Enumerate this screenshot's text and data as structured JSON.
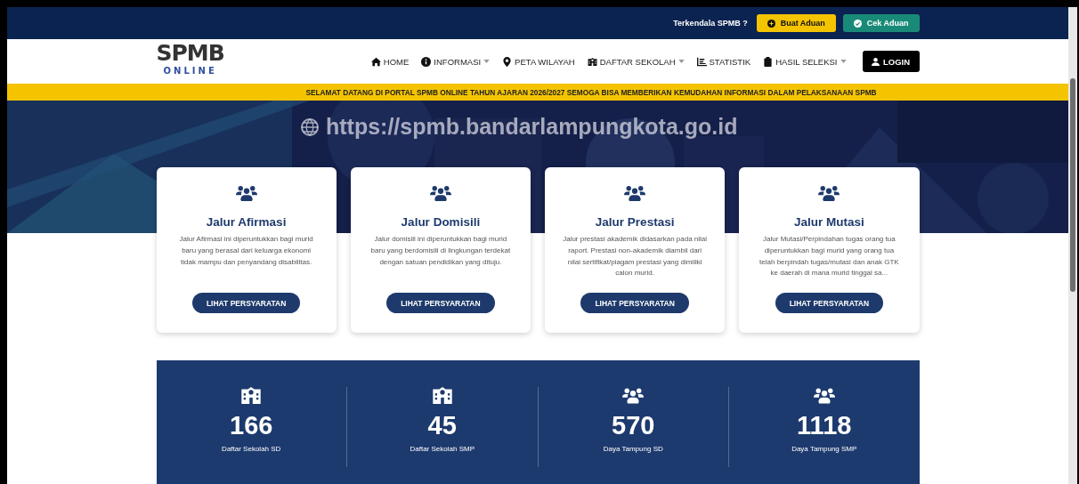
{
  "topbar": {
    "prompt": "Terkendala SPMB ?",
    "buttons": [
      {
        "label": "Buat Aduan",
        "kind": "report"
      },
      {
        "label": "Cek Aduan",
        "kind": "check"
      }
    ]
  },
  "logo": {
    "title": "SPMB",
    "subtitle": "ONLINE"
  },
  "nav": [
    {
      "label": "HOME",
      "kind": "home",
      "dropdown": false
    },
    {
      "label": "INFORMASI",
      "kind": "info",
      "dropdown": true
    },
    {
      "label": "PETA WILAYAH",
      "kind": "pin",
      "dropdown": false
    },
    {
      "label": "DAFTAR SEKOLAH",
      "kind": "school",
      "dropdown": true
    },
    {
      "label": "STATISTIK",
      "kind": "chart",
      "dropdown": false
    },
    {
      "label": "HASIL SELEKSI",
      "kind": "clipboard",
      "dropdown": true
    }
  ],
  "login": {
    "label": "LOGIN"
  },
  "announcement": "SELAMAT DATANG DI PORTAL SPMB ONLINE TAHUN AJARAN 2026/2027 SEMOGA BISA MEMBERIKAN KEMUDAHAN INFORMASI DALAM PELAKSANAAN SPMB",
  "hero": {
    "kind": "picture",
    "url": "https://spmb.bandarlampungkota.go.id"
  },
  "cards": [
    {
      "title": "Jalur Afirmasi",
      "text": "Jalur Afirmasi ini diperuntukkan bagi murid baru yang berasal dari keluarga ekonomi tidak mampu dan penyandang disabilitas.",
      "button": "LIHAT PERSYARATAN"
    },
    {
      "title": "Jalur Domisili",
      "text": "Jalur domisili ini diperuntukkan bagi murid baru yang berdomisili di lingkungan terdekat dengan satuan pendidikan yang dituju.",
      "button": "LIHAT PERSYARATAN"
    },
    {
      "title": "Jalur Prestasi",
      "text": "Jalur prestasi akademik didasarkan pada nilai raport. Prestasi non-akademik diambil dari nilai sertifikat/piagam prestasi yang dimiliki calon murid.",
      "button": "LIHAT PERSYARATAN"
    },
    {
      "title": "Jalur Mutasi",
      "text": "Jalur Mutasi/Perpindahan tugas orang tua diperuntukkan bagi murid yang orang tua telah berpindah tugas/mutasi dan anak GTK ke daerah di mana murid tinggal sa...",
      "button": "LIHAT PERSYARATAN"
    }
  ],
  "stats": [
    {
      "kind": "school",
      "value": "166",
      "label": "Daftar Sekolah SD"
    },
    {
      "kind": "school",
      "value": "45",
      "label": "Daftar Sekolah SMP"
    },
    {
      "kind": "users",
      "value": "570",
      "label": "Daya Tampung SD"
    },
    {
      "kind": "users",
      "value": "1118",
      "label": "Daya Tampung SMP"
    }
  ]
}
